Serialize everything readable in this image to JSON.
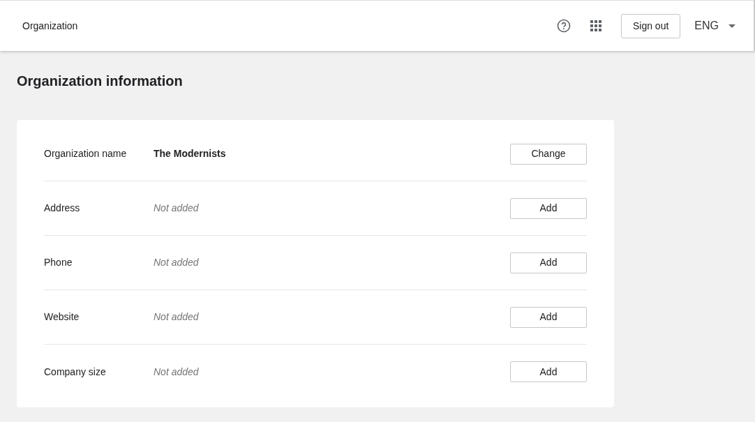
{
  "header": {
    "title": "Organization",
    "sign_out": "Sign out",
    "language": "ENG"
  },
  "page_title": "Organization information",
  "fields": [
    {
      "label": "Organization name",
      "kind": "set",
      "value": "The Modernists",
      "action": "Change"
    },
    {
      "label": "Address",
      "kind": "empty",
      "value": "Not added",
      "action": "Add"
    },
    {
      "label": "Phone",
      "kind": "empty",
      "value": "Not added",
      "action": "Add"
    },
    {
      "label": "Website",
      "kind": "empty",
      "value": "Not added",
      "action": "Add"
    },
    {
      "label": "Company size",
      "kind": "empty",
      "value": "Not added",
      "action": "Add"
    }
  ]
}
